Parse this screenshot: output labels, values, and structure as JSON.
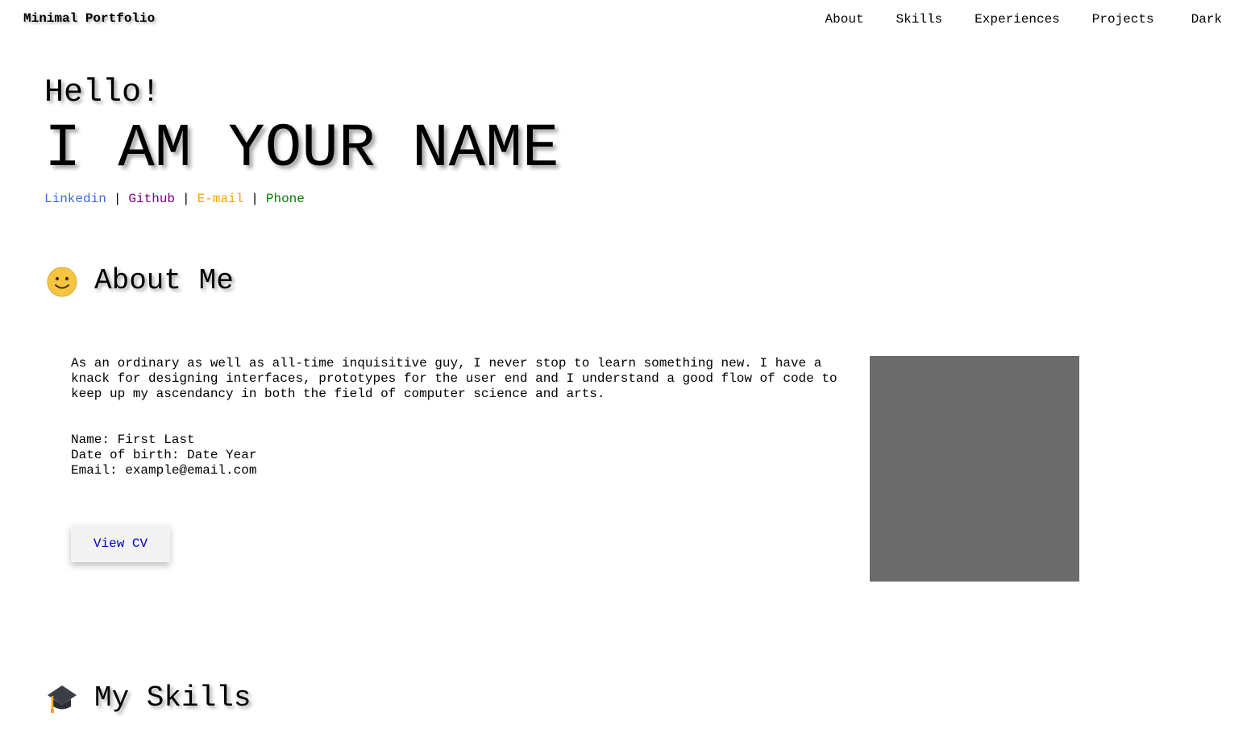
{
  "navbar": {
    "brand": "Minimal Portfolio",
    "links": [
      "About",
      "Skills",
      "Experiences",
      "Projects"
    ],
    "theme_toggle": "Dark"
  },
  "hero": {
    "greeting": "Hello!",
    "name": "I AM YOUR NAME",
    "contacts": [
      {
        "label": "Linkedin",
        "color": "#4169e1"
      },
      {
        "label": "Github",
        "color": "#800080"
      },
      {
        "label": "E-mail",
        "color": "#f0a30a"
      },
      {
        "label": "Phone",
        "color": "#008000"
      }
    ],
    "separator": "|"
  },
  "about": {
    "icon": "smiley-face-icon",
    "heading": "About Me",
    "bio": "As an ordinary as well as all-time inquisitive guy, I never stop to learn something new. I have a knack for designing interfaces, prototypes for the user end and I understand a good flow of code to keep up my ascendancy in both the field of computer science and arts.",
    "details": {
      "name": "Name: First Last",
      "dob": "Date of birth: Date Year",
      "email": "Email: example@email.com"
    },
    "cv_button": {
      "label": "View CV",
      "color": "#0000cd"
    },
    "photo_color": "#6b6b6b"
  },
  "skills": {
    "icon": "graduation-cap-icon",
    "heading": "My Skills"
  }
}
